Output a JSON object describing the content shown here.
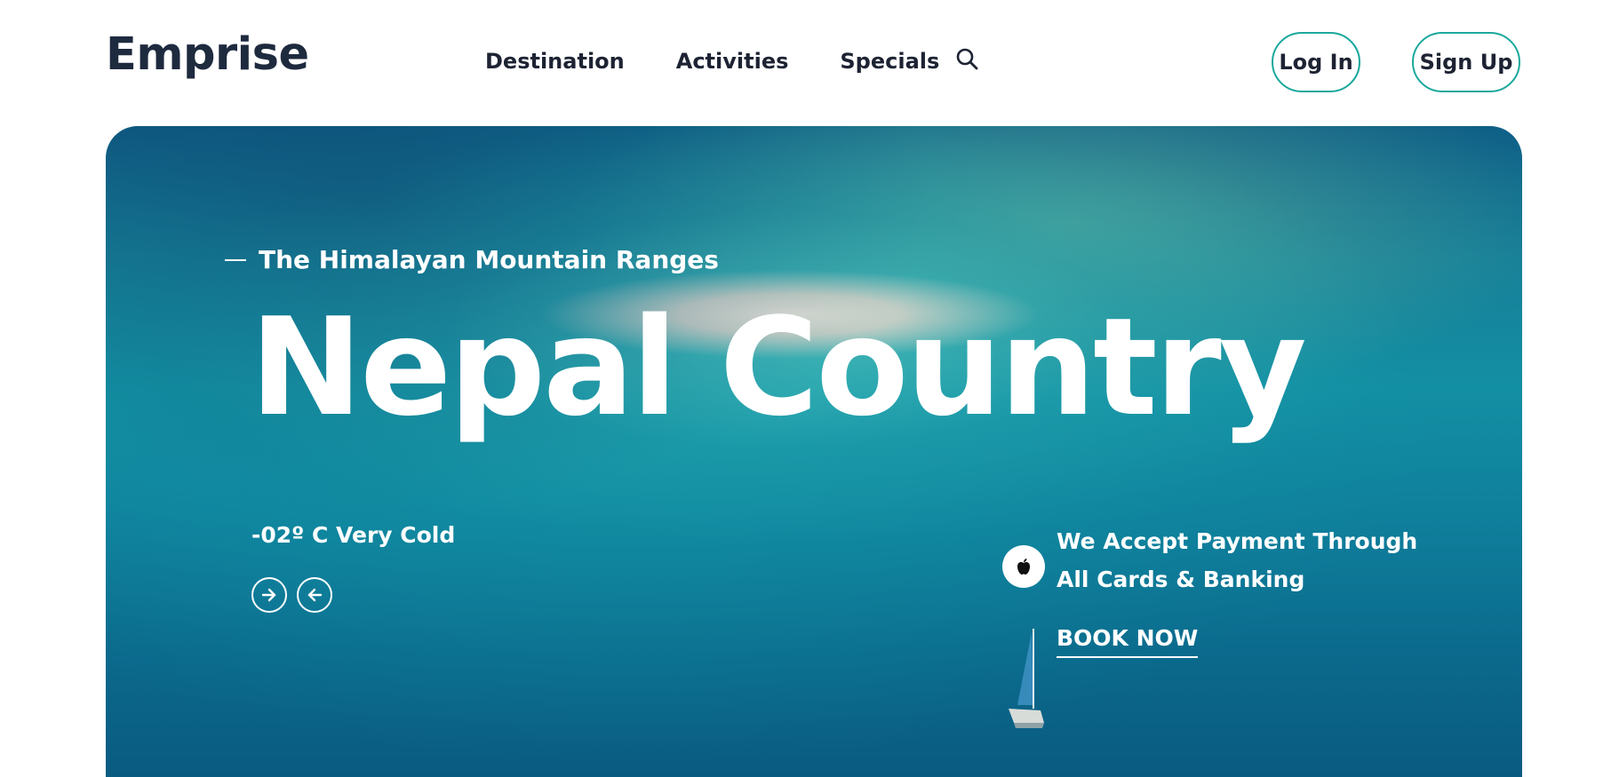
{
  "brand": {
    "logo": "Emprise"
  },
  "nav": {
    "items": [
      {
        "label": "Destination"
      },
      {
        "label": "Activities"
      },
      {
        "label": "Specials"
      }
    ],
    "search_icon": "search-icon"
  },
  "auth": {
    "login_label": "Log In",
    "signup_label": "Sign Up"
  },
  "hero": {
    "subtitle": "The Himalayan Mountain Ranges",
    "title": "Nepal Country",
    "temperature": "-02º C Very Cold",
    "payment_line1": "We Accept Payment Through",
    "payment_line2": "All Cards & Banking",
    "payment_icon": "apple-icon",
    "cta_label": "BOOK NOW",
    "next_icon": "arrow-right-icon",
    "prev_icon": "arrow-left-icon"
  },
  "colors": {
    "accent": "#19a89c",
    "text_dark": "#1d2333",
    "logo": "#1e2a3e"
  }
}
